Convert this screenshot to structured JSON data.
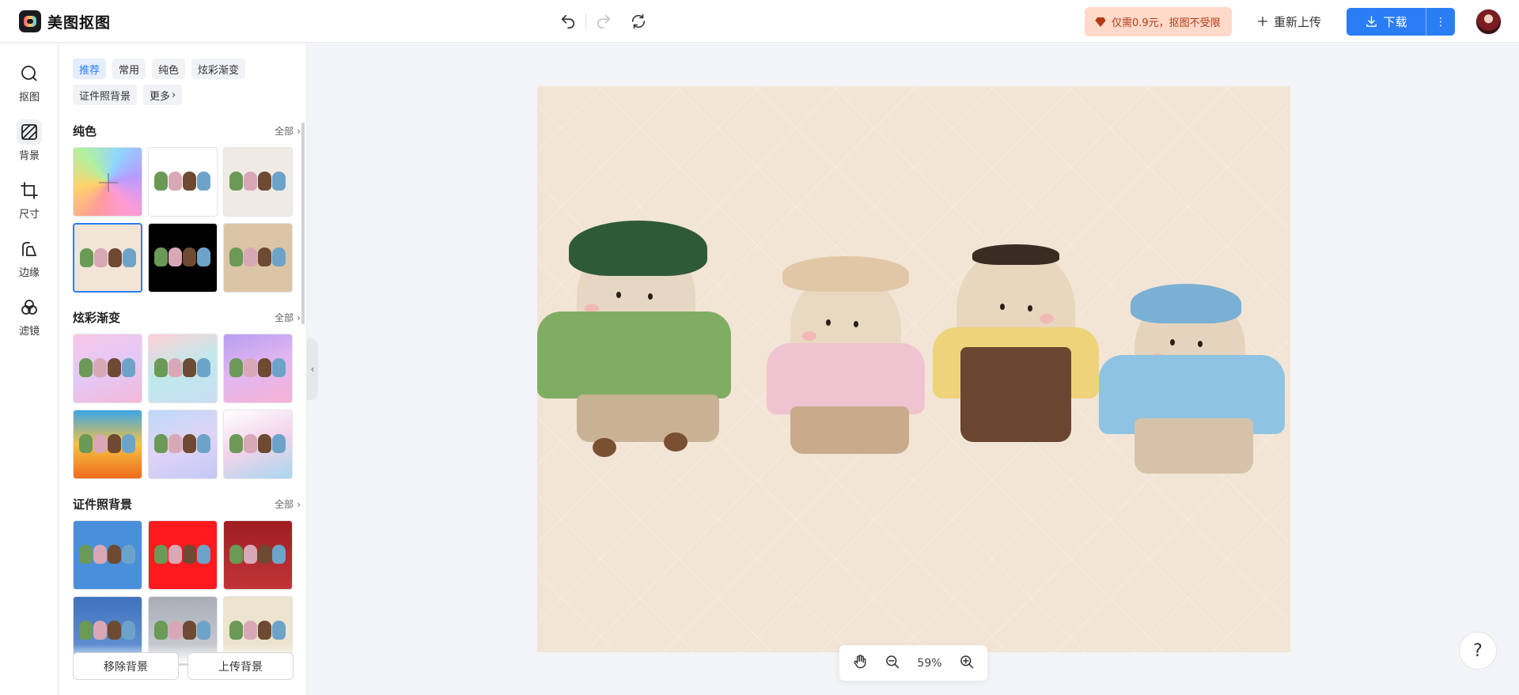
{
  "app": {
    "logo_text": "美图抠图"
  },
  "header": {
    "promo_text": "仅需0.9元，抠图不受限",
    "reupload_label": "重新上传",
    "download_label": "下载",
    "icons": [
      "undo-icon",
      "redo-icon",
      "refresh-icon",
      "diamond-icon",
      "plus-icon",
      "download-icon",
      "more-vertical-icon"
    ]
  },
  "rail": {
    "items": [
      {
        "label": "抠图",
        "icon": "cutout-icon"
      },
      {
        "label": "背景",
        "icon": "background-icon",
        "active": true
      },
      {
        "label": "尺寸",
        "icon": "crop-icon"
      },
      {
        "label": "边缘",
        "icon": "edge-icon"
      },
      {
        "label": "滤镜",
        "icon": "filter-icon"
      }
    ]
  },
  "panel": {
    "chips": [
      "推荐",
      "常用",
      "纯色",
      "炫彩渐变",
      "证件照背景",
      "更多"
    ],
    "active_chip": "推荐",
    "all_label": "全部",
    "sections": [
      {
        "title": "纯色",
        "tiles": [
          "#ffd1e0",
          "#ffffff",
          "#efebe4",
          "#f2e5d6",
          "#000000",
          "#dcc5a7"
        ],
        "selected_index": 3
      },
      {
        "title": "炫彩渐变",
        "tiles": [
          "#f6c8e3",
          "#bfe9ec",
          "#d8b4f0",
          "#f6a13a",
          "#d5d8f7",
          "#cde9f5"
        ]
      },
      {
        "title": "证件照背景",
        "tiles": [
          "#4a8fdc",
          "#ff1a1f",
          "#b42a2e",
          "#4c80c8",
          "#b9bcc4",
          "#ece4ce"
        ]
      }
    ],
    "remove_bg_label": "移除背景",
    "upload_bg_label": "上传背景"
  },
  "canvas": {
    "background": "#f2e5d6"
  },
  "zoom": {
    "value": "59%"
  },
  "help": {
    "label": "?"
  }
}
